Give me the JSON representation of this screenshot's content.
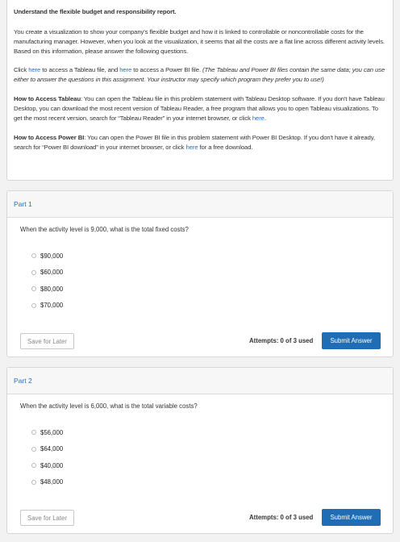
{
  "intro": {
    "title": "Understand the flexible budget and responsibility report.",
    "p1": "You create a visualization to show your company's flexible budget and how it is linked to controllable or noncontrollable costs for the manufacturing manager. However, when you look at the visualization, it seems that all the costs are a flat line across different activity levels. Based on this information, please answer the following questions.",
    "p2": {
      "click": "Click ",
      "here1": "here",
      "mid": " to access a Tableau file, and ",
      "here2": "here",
      "after": " to access a Power BI file. ",
      "italic": "(The Tableau and Power BI files contain the same data; you can use either to answer the questions in this assignment. Your instructor may specify which program they prefer you to use!)"
    },
    "p3": {
      "label": "How to Access Tableau",
      "text": ": You can open the Tableau file in this problem statement with Tableau Desktop software. If you don't have Tableau Desktop, you can download the most recent version of Tableau Reader, a free program that allows you to open Tableau visualizations. To get the most recent version, search for “Tableau Reader” in your internet browser, or click ",
      "here": "here",
      "end": "."
    },
    "p4": {
      "label": "How to Access Power BI",
      "text": ": You can open the Power BI file in this problem statement with Power BI Desktop. If you don't have it already, search for “Power BI download” in your internet browser, or click ",
      "here": "here",
      "end": " for a free download."
    }
  },
  "parts": [
    {
      "title": "Part 1",
      "question": "When the activity level is 9,000, what is the total fixed costs?",
      "options": [
        "$90,000",
        "$60,000",
        "$80,000",
        "$70,000"
      ],
      "save_label": "Save for Later",
      "attempts": "Attempts: 0 of 3 used",
      "submit_label": "Submit Answer"
    },
    {
      "title": "Part 2",
      "question": "When the activity level is 6,000, what is the total variable costs?",
      "options": [
        "$56,000",
        "$64,000",
        "$40,000",
        "$48,000"
      ],
      "save_label": "Save for Later",
      "attempts": "Attempts: 0 of 3 used",
      "submit_label": "Submit Answer"
    }
  ]
}
